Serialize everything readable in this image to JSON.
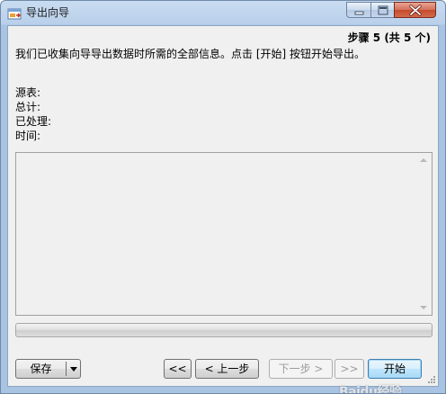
{
  "window": {
    "title": "导出向导"
  },
  "header": {
    "step": "步骤 5 (共 5 个)",
    "intro": "我们已收集向导导出数据时所需的全部信息。点击 [开始] 按钮开始导出。"
  },
  "info": {
    "source_label": "源表:",
    "total_label": "总计:",
    "processed_label": "已处理:",
    "time_label": "时间:"
  },
  "progress": {
    "value_percent": 0
  },
  "buttons": {
    "save": "保存",
    "first": "<<",
    "prev": "< 上一步",
    "next": "下一步 >",
    "last": ">>",
    "start": "开始"
  },
  "icons": {
    "app": "export-wizard-icon",
    "minimize": "minimize-icon",
    "maximize": "maximize-icon",
    "close": "close-icon",
    "dropdown": "chevron-down-icon"
  },
  "watermark": "Baidu经验",
  "colors": {
    "titlebar": "#b9d0ea",
    "close_button": "#c44a2e",
    "client_bg": "#f0f0f0"
  }
}
